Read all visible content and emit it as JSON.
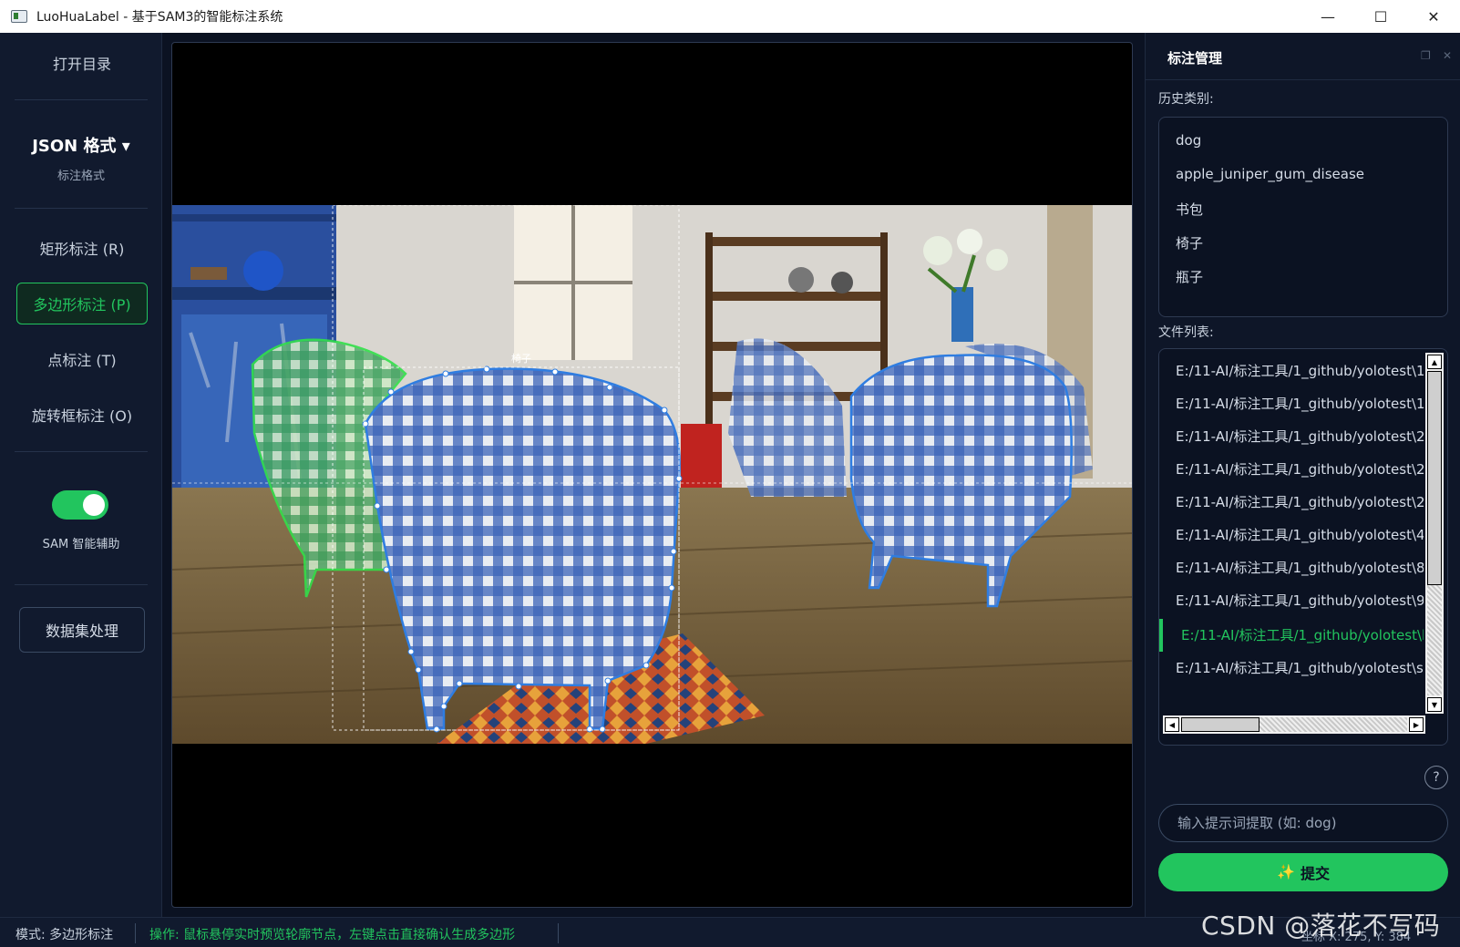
{
  "window": {
    "title": "LuoHuaLabel - 基于SAM3的智能标注系统",
    "minimize": "—",
    "maximize": "☐",
    "close": "✕"
  },
  "sidebar": {
    "open_dir": "打开目录",
    "format_title": "JSON 格式 ▾",
    "format_sub": "标注格式",
    "tools": [
      {
        "label": "矩形标注 (R)",
        "active": false
      },
      {
        "label": "多边形标注 (P)",
        "active": true
      },
      {
        "label": "点标注 (T)",
        "active": false
      },
      {
        "label": "旋转框标注 (O)",
        "active": false
      }
    ],
    "sam_label": "SAM 智能辅助",
    "sam_enabled": true,
    "dataset": "数据集处理"
  },
  "canvas": {
    "label_text": "椅子"
  },
  "panel": {
    "title": "标注管理",
    "history_label": "历史类别:",
    "history": [
      "dog",
      "apple_juniper_gum_disease",
      "书包",
      "椅子",
      "瓶子"
    ],
    "file_label": "文件列表:",
    "files": [
      "E:/11-AI/标注工具/1_github/yolotest\\1",
      "E:/11-AI/标注工具/1_github/yolotest\\1",
      "E:/11-AI/标注工具/1_github/yolotest\\2",
      "E:/11-AI/标注工具/1_github/yolotest\\2",
      "E:/11-AI/标注工具/1_github/yolotest\\2",
      "E:/11-AI/标注工具/1_github/yolotest\\4",
      "E:/11-AI/标注工具/1_github/yolotest\\8",
      "E:/11-AI/标注工具/1_github/yolotest\\9",
      "E:/11-AI/标注工具/1_github/yolotest\\l",
      "E:/11-AI/标注工具/1_github/yolotest\\s"
    ],
    "selected_index": 8,
    "help": "?",
    "prompt_placeholder": "输入提示词提取 (如: dog)",
    "submit_icon": "✨",
    "submit_label": "提交"
  },
  "status": {
    "mode": "模式: 多边形标注",
    "operation": "操作: 鼠标悬停实时预览轮廓节点，左键点击直接确认生成多边形",
    "coords": "坐标 X: 275, Y: 384"
  },
  "watermark": "CSDN @落花不写码",
  "colors": {
    "accent": "#22c55e",
    "background": "#0b1222",
    "sidebar": "#111a2e",
    "polygon_blue": "#2f7de1",
    "polygon_green": "#32e04a"
  }
}
